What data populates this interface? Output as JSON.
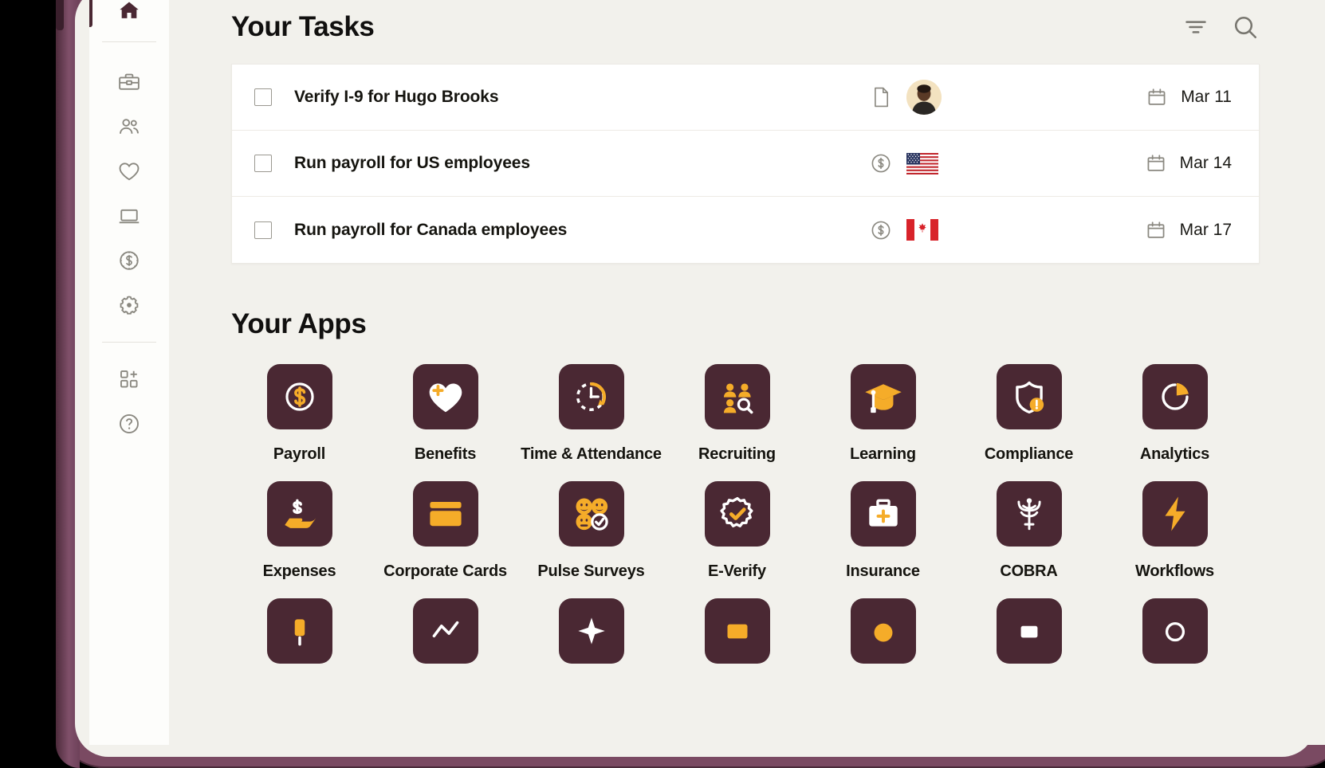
{
  "theme": {
    "page_bg": "#f2f1ec",
    "card_bg": "#ffffff",
    "device_frame": "#7a4a62",
    "accent_dark": "#4a2833",
    "accent_orange": "#f5ac29",
    "text_primary": "#15140f",
    "icon_muted": "#8a8880"
  },
  "sidebar": {
    "items": [
      {
        "icon": "home-icon",
        "active": true
      },
      {
        "icon": "briefcase-icon",
        "active": false
      },
      {
        "icon": "people-icon",
        "active": false
      },
      {
        "icon": "heart-icon",
        "active": false
      },
      {
        "icon": "laptop-icon",
        "active": false
      },
      {
        "icon": "dollar-clock-icon",
        "active": false
      },
      {
        "icon": "gear-icon",
        "active": false
      },
      {
        "icon": "app-grid-plus-icon",
        "active": false
      },
      {
        "icon": "help-circle-icon",
        "active": false
      }
    ]
  },
  "tasks_section": {
    "title": "Your Tasks",
    "actions": [
      {
        "name": "filter-icon",
        "label": "Filter"
      },
      {
        "name": "search-icon",
        "label": "Search"
      }
    ],
    "rows": [
      {
        "title": "Verify I-9 for Hugo Brooks",
        "type_icon": "document-icon",
        "badge": "avatar",
        "due": "Mar 11",
        "checked": false
      },
      {
        "title": "Run payroll for US employees",
        "type_icon": "dollar-circle-icon",
        "badge": "flag-us",
        "due": "Mar 14",
        "checked": false
      },
      {
        "title": "Run payroll for Canada employees",
        "type_icon": "dollar-circle-icon",
        "badge": "flag-ca",
        "due": "Mar 17",
        "checked": false
      }
    ]
  },
  "apps_section": {
    "title": "Your Apps",
    "apps": [
      {
        "label": "Payroll",
        "icon": "dollar-circle-app-icon"
      },
      {
        "label": "Benefits",
        "icon": "heart-plus-app-icon"
      },
      {
        "label": "Time & Attendance",
        "icon": "clock-arrow-app-icon"
      },
      {
        "label": "Recruiting",
        "icon": "people-search-app-icon"
      },
      {
        "label": "Learning",
        "icon": "graduation-cap-app-icon"
      },
      {
        "label": "Compliance",
        "icon": "shield-alert-app-icon"
      },
      {
        "label": "Analytics",
        "icon": "pie-chart-app-icon"
      },
      {
        "label": "Expenses",
        "icon": "hand-dollar-app-icon"
      },
      {
        "label": "Corporate Cards",
        "icon": "credit-card-app-icon"
      },
      {
        "label": "Pulse Surveys",
        "icon": "smiley-faces-app-icon"
      },
      {
        "label": "E-Verify",
        "icon": "badge-check-app-icon"
      },
      {
        "label": "Insurance",
        "icon": "medical-kit-app-icon"
      },
      {
        "label": "COBRA",
        "icon": "caduceus-app-icon"
      },
      {
        "label": "Workflows",
        "icon": "lightning-bolt-app-icon"
      },
      {
        "label": "",
        "icon": "partial-app-icon-1"
      },
      {
        "label": "",
        "icon": "partial-app-icon-2"
      },
      {
        "label": "",
        "icon": "partial-app-icon-3"
      },
      {
        "label": "",
        "icon": "partial-app-icon-4"
      },
      {
        "label": "",
        "icon": "partial-app-icon-5"
      },
      {
        "label": "",
        "icon": "partial-app-icon-6"
      },
      {
        "label": "",
        "icon": "partial-app-icon-7"
      }
    ]
  }
}
